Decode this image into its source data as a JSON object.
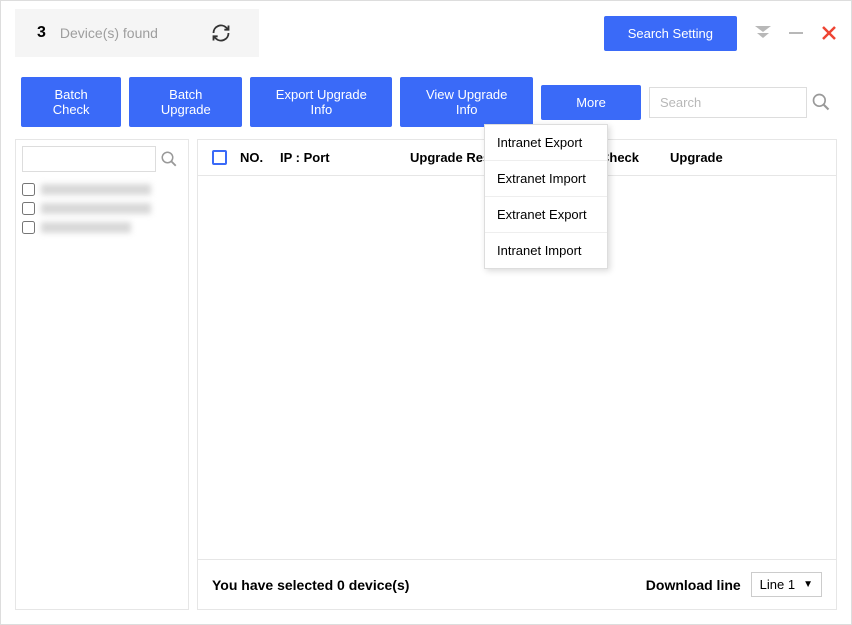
{
  "header": {
    "device_count": "3",
    "device_label": "Device(s) found",
    "search_setting_label": "Search Setting"
  },
  "toolbar": {
    "batch_check": "Batch Check",
    "batch_upgrade": "Batch Upgrade",
    "export_upgrade_info": "Export Upgrade Info",
    "view_upgrade_info": "View Upgrade Info",
    "more": "More",
    "search_placeholder": "Search"
  },
  "dropdown": {
    "items": [
      {
        "label": "Intranet Export"
      },
      {
        "label": "Extranet Import"
      },
      {
        "label": "Extranet Export"
      },
      {
        "label": "Intranet Import"
      }
    ]
  },
  "sidebar": {
    "search_placeholder": ""
  },
  "table": {
    "columns": {
      "no": "NO.",
      "ip_port": "IP : Port",
      "upgrade_result": "Upgrade Resu",
      "check": "Check",
      "upgrade": "Upgrade"
    }
  },
  "footer": {
    "selected_text": "You have selected 0  device(s)",
    "download_line_label": "Download line",
    "line_value": "Line 1"
  }
}
